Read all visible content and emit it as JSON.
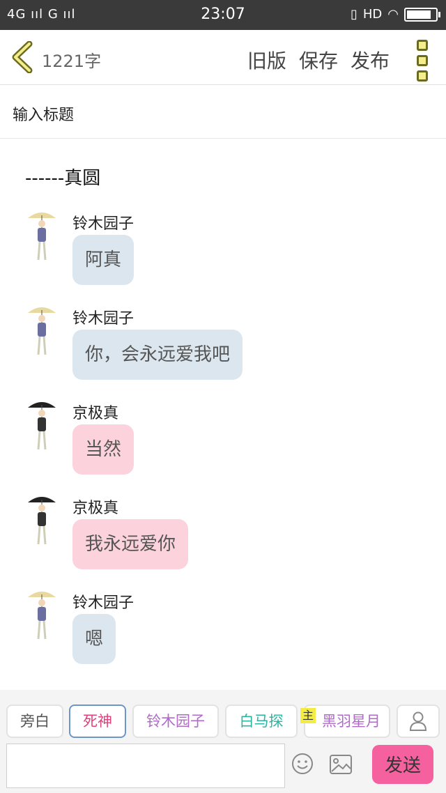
{
  "status_bar": {
    "network": "4G",
    "carrier": "G",
    "time": "23:07",
    "hd": "HD"
  },
  "toolbar": {
    "char_count": "1221字",
    "old_version": "旧版",
    "save": "保存",
    "publish": "发布"
  },
  "title_input": {
    "placeholder": "输入标题"
  },
  "story": {
    "heading": "------真圆",
    "messages": [
      {
        "speaker": "铃木园子",
        "text": "阿真",
        "bubble_color": "#dbe6ee",
        "avatar_icon": "sonoko-avatar-icon"
      },
      {
        "speaker": "铃木园子",
        "text": "你，会永远爱我吧",
        "bubble_color": "#dbe6ee",
        "avatar_icon": "sonoko-avatar-icon"
      },
      {
        "speaker": "京极真",
        "text": "当然",
        "bubble_color": "#fcd3dc",
        "avatar_icon": "makoto-avatar-icon"
      },
      {
        "speaker": "京极真",
        "text": "我永远爱你",
        "bubble_color": "#fcd3dc",
        "avatar_icon": "makoto-avatar-icon"
      },
      {
        "speaker": "铃木园子",
        "text": "嗯",
        "bubble_color": "#dbe6ee",
        "avatar_icon": "sonoko-avatar-icon"
      }
    ]
  },
  "characters": [
    {
      "label": "旁白",
      "color": "#555555"
    },
    {
      "label": "死神",
      "color": "#e0407a"
    },
    {
      "label": "铃木园子",
      "color": "#b06ac8"
    },
    {
      "label": "白马探",
      "color": "#2bb5a0"
    },
    {
      "label": "黑羽星月",
      "color": "#b06ac8"
    }
  ],
  "host_badge": "主",
  "composer": {
    "send_label": "发送"
  },
  "colors": {
    "accent": "#f5609e",
    "bubble_blue": "#dbe6ee",
    "bubble_pink": "#fcd3dc"
  }
}
